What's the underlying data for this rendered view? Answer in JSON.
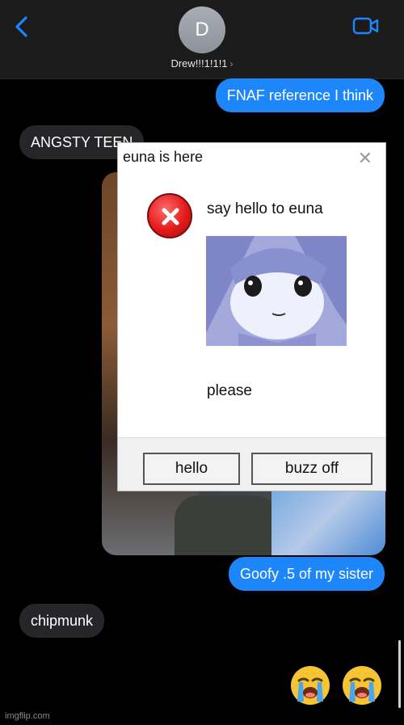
{
  "header": {
    "avatar_initial": "D",
    "contact_name": "Drew!!!1!1!1",
    "chevron": "›"
  },
  "messages": [
    {
      "side": "sent",
      "text": "FNAF reference I think"
    },
    {
      "side": "received",
      "text": "ANGSTY TEEN"
    },
    {
      "side": "sent",
      "text": "Goofy .5 of my sister"
    },
    {
      "side": "received",
      "text": "chipmunk"
    }
  ],
  "dialog": {
    "title": "euna is here",
    "close": "✕",
    "message": "say hello to euna",
    "footer_text": "please",
    "buttons": {
      "hello": "hello",
      "buzz_off": "buzz off"
    }
  },
  "reactions": {
    "emoji_1": "😭",
    "emoji_2": "😭"
  },
  "watermark": "imgflip.com",
  "colors": {
    "sent_bubble": "#1e86fb",
    "received_bubble": "#262628",
    "accent": "#1e86fb"
  }
}
